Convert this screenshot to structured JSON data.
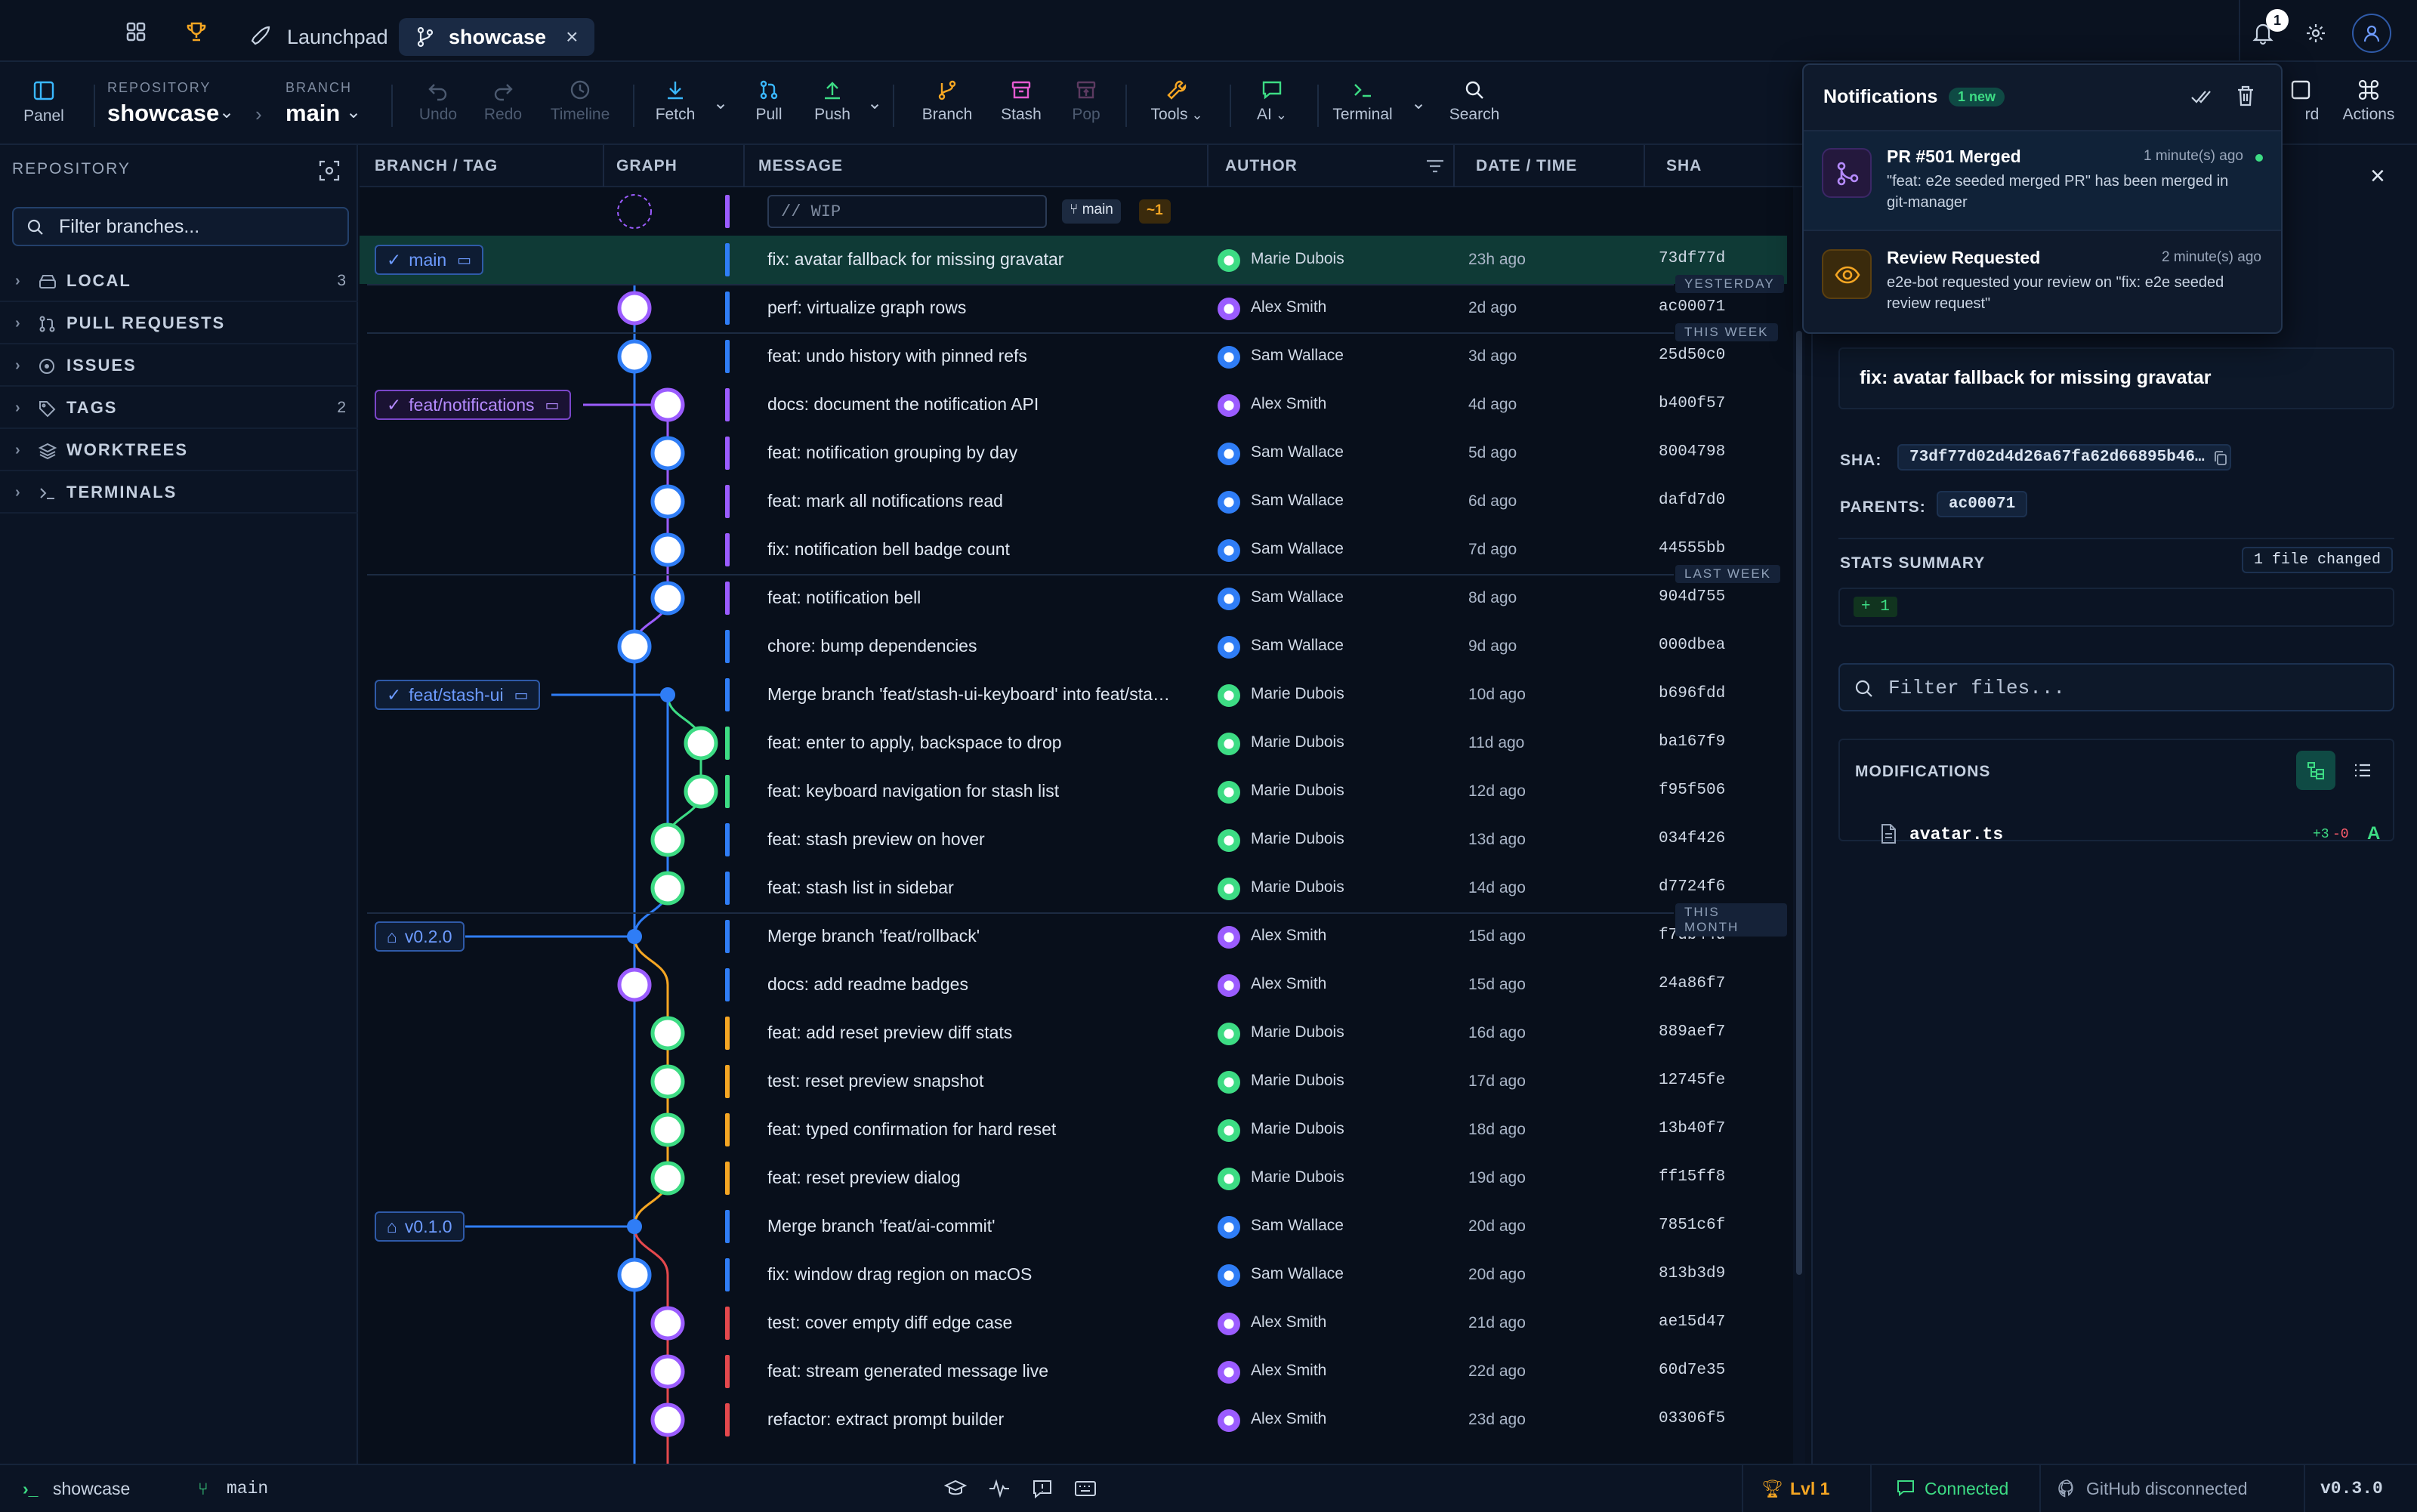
{
  "titlebar": {
    "tabs": [
      {
        "label": "Launchpad"
      },
      {
        "label": "showcase"
      }
    ],
    "notification_count": "1"
  },
  "toolbar": {
    "panel": "Panel",
    "repo_label": "REPOSITORY",
    "repo_value": "showcase",
    "branch_label": "BRANCH",
    "branch_value": "main",
    "undo": "Undo",
    "redo": "Redo",
    "timeline": "Timeline",
    "fetch": "Fetch",
    "pull": "Pull",
    "push": "Push",
    "branch": "Branch",
    "stash": "Stash",
    "pop": "Pop",
    "tools": "Tools",
    "ai": "AI",
    "terminal": "Terminal",
    "search": "Search",
    "actions": "Actions",
    "dashboard_partial": "rd"
  },
  "sidebar": {
    "heading": "REPOSITORY",
    "filter_placeholder": "Filter branches...",
    "sections": [
      {
        "label": "LOCAL",
        "count": "3"
      },
      {
        "label": "PULL REQUESTS",
        "count": ""
      },
      {
        "label": "ISSUES",
        "count": ""
      },
      {
        "label": "TAGS",
        "count": "2"
      },
      {
        "label": "WORKTREES",
        "count": ""
      },
      {
        "label": "TERMINALS",
        "count": ""
      }
    ]
  },
  "columns": {
    "branch_tag": "BRANCH / TAG",
    "graph": "GRAPH",
    "message": "MESSAGE",
    "author": "AUTHOR",
    "date": "DATE / TIME",
    "sha": "SHA"
  },
  "wip": {
    "placeholder": "// WIP",
    "branch": "main",
    "changes": "~1"
  },
  "refs": [
    {
      "label": "main",
      "row": 1,
      "style": "blue"
    },
    {
      "label": "feat/notifications",
      "row": 4,
      "style": "purple"
    },
    {
      "label": "feat/stash-ui",
      "row": 10,
      "style": "blue"
    },
    {
      "label": "v0.2.0",
      "row": 15,
      "style": "tag"
    },
    {
      "label": "v0.1.0",
      "row": 21,
      "style": "tag"
    }
  ],
  "sections": [
    {
      "label": "YESTERDAY",
      "row": 2
    },
    {
      "label": "THIS WEEK",
      "row": 3
    },
    {
      "label": "LAST WEEK",
      "row": 8
    },
    {
      "label": "THIS MONTH",
      "row": 15
    }
  ],
  "commits": [
    {
      "message": "fix: avatar fallback for missing gravatar",
      "author": "Marie Dubois",
      "date": "23h ago",
      "sha": "73df77d"
    },
    {
      "message": "perf: virtualize graph rows",
      "author": "Alex Smith",
      "date": "2d ago",
      "sha": "ac00071"
    },
    {
      "message": "feat: undo history with pinned refs",
      "author": "Sam Wallace",
      "date": "3d ago",
      "sha": "25d50c0"
    },
    {
      "message": "docs: document the notification API",
      "author": "Alex Smith",
      "date": "4d ago",
      "sha": "b400f57"
    },
    {
      "message": "feat: notification grouping by day",
      "author": "Sam Wallace",
      "date": "5d ago",
      "sha": "8004798"
    },
    {
      "message": "feat: mark all notifications read",
      "author": "Sam Wallace",
      "date": "6d ago",
      "sha": "dafd7d0"
    },
    {
      "message": "fix: notification bell badge count",
      "author": "Sam Wallace",
      "date": "7d ago",
      "sha": "44555bb"
    },
    {
      "message": "feat: notification bell",
      "author": "Sam Wallace",
      "date": "8d ago",
      "sha": "904d755"
    },
    {
      "message": "chore: bump dependencies",
      "author": "Sam Wallace",
      "date": "9d ago",
      "sha": "000dbea"
    },
    {
      "message": "Merge branch 'feat/stash-ui-keyboard' into feat/sta…",
      "author": "Marie Dubois",
      "date": "10d ago",
      "sha": "b696fdd"
    },
    {
      "message": "feat: enter to apply, backspace to drop",
      "author": "Marie Dubois",
      "date": "11d ago",
      "sha": "ba167f9"
    },
    {
      "message": "feat: keyboard navigation for stash list",
      "author": "Marie Dubois",
      "date": "12d ago",
      "sha": "f95f506"
    },
    {
      "message": "feat: stash preview on hover",
      "author": "Marie Dubois",
      "date": "13d ago",
      "sha": "034f426"
    },
    {
      "message": "feat: stash list in sidebar",
      "author": "Marie Dubois",
      "date": "14d ago",
      "sha": "d7724f6"
    },
    {
      "message": "Merge branch 'feat/rollback'",
      "author": "Alex Smith",
      "date": "15d ago",
      "sha": "f7db44d"
    },
    {
      "message": "docs: add readme badges",
      "author": "Alex Smith",
      "date": "15d ago",
      "sha": "24a86f7"
    },
    {
      "message": "feat: add reset preview diff stats",
      "author": "Marie Dubois",
      "date": "16d ago",
      "sha": "889aef7"
    },
    {
      "message": "test: reset preview snapshot",
      "author": "Marie Dubois",
      "date": "17d ago",
      "sha": "12745fe"
    },
    {
      "message": "feat: typed confirmation for hard reset",
      "author": "Marie Dubois",
      "date": "18d ago",
      "sha": "13b40f7"
    },
    {
      "message": "feat: reset preview dialog",
      "author": "Marie Dubois",
      "date": "19d ago",
      "sha": "ff15ff8"
    },
    {
      "message": "Merge branch 'feat/ai-commit'",
      "author": "Sam Wallace",
      "date": "20d ago",
      "sha": "7851c6f"
    },
    {
      "message": "fix: window drag region on macOS",
      "author": "Sam Wallace",
      "date": "20d ago",
      "sha": "813b3d9"
    },
    {
      "message": "test: cover empty diff edge case",
      "author": "Alex Smith",
      "date": "21d ago",
      "sha": "ae15d47"
    },
    {
      "message": "feat: stream generated message live",
      "author": "Alex Smith",
      "date": "22d ago",
      "sha": "60d7e35"
    },
    {
      "message": "refactor: extract prompt builder",
      "author": "Alex Smith",
      "date": "23d ago",
      "sha": "03306f5"
    }
  ],
  "details": {
    "title": "fix: avatar fallback for missing gravatar",
    "sha_label": "SHA:",
    "sha": "73df77d02d4d26a67fa62d66895b46…",
    "parents_label": "PARENTS:",
    "parent": "ac00071",
    "stats_label": "STATS SUMMARY",
    "files_changed": "1 file changed",
    "additions": "+ 1",
    "filter_placeholder": "Filter files...",
    "modifications_label": "MODIFICATIONS",
    "file": {
      "name": "avatar.ts",
      "diff_add": "+3",
      "diff_del": "-0",
      "status": "A"
    }
  },
  "notifications": {
    "title": "Notifications",
    "badge": "1 new",
    "items": [
      {
        "title": "PR #501 Merged",
        "time": "1 minute(s) ago",
        "body": "\"feat: e2e seeded merged PR\" has been merged in git-manager"
      },
      {
        "title": "Review Requested",
        "time": "2 minute(s) ago",
        "body": "e2e-bot requested your review on \"fix: e2e seeded review request\""
      }
    ]
  },
  "statusbar": {
    "repo": "showcase",
    "branch": "main",
    "level": "Lvl 1",
    "connection": "Connected",
    "github": "GitHub disconnected",
    "version": "v0.3.0"
  },
  "colors": {
    "accent": "#2f7df6",
    "selected_row": "#0f3a36",
    "success": "#3ddc84",
    "purple": "#9b5cff",
    "orange": "#f5a623"
  }
}
